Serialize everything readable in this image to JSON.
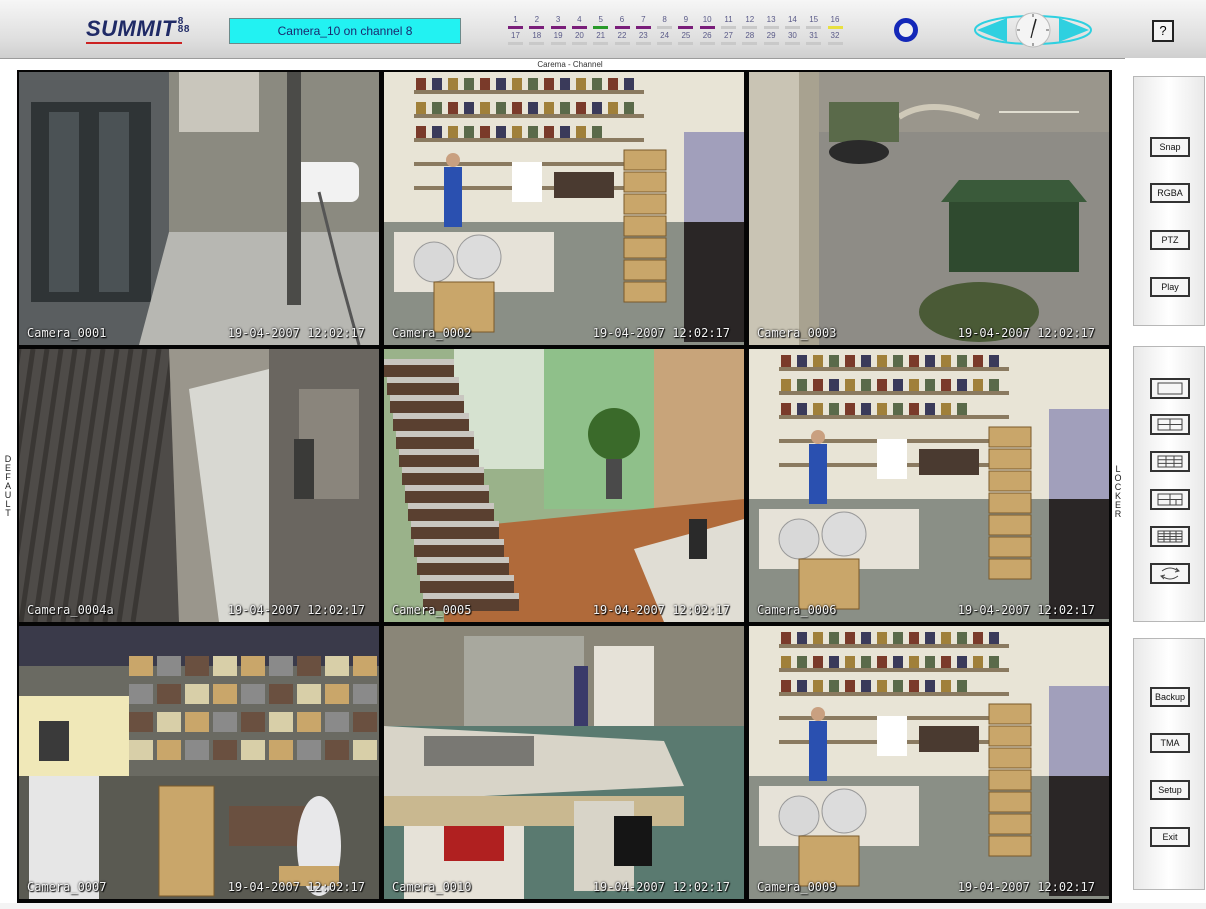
{
  "app": {
    "logo_text": "SUMMIT",
    "logo_badge_top": "8",
    "logo_badge_bottom": "88",
    "status_text": "Camera_10 on channel 8",
    "help_label": "?"
  },
  "grid": {
    "title": "Carema - Channel",
    "left_label": [
      "D",
      "E",
      "F",
      "A",
      "U",
      "L",
      "T"
    ],
    "right_label": [
      "L",
      "O",
      "C",
      "K",
      "E",
      "R"
    ]
  },
  "channels": [
    {
      "n": "1",
      "color": "#7a1e7a"
    },
    {
      "n": "2",
      "color": "#7a1e7a"
    },
    {
      "n": "3",
      "color": "#7a1e7a"
    },
    {
      "n": "4",
      "color": "#7a1e7a"
    },
    {
      "n": "5",
      "color": "#2a9a2a"
    },
    {
      "n": "6",
      "color": "#7a1e7a"
    },
    {
      "n": "7",
      "color": "#7a1e7a"
    },
    {
      "n": "8",
      "color": "#c9c9c9"
    },
    {
      "n": "9",
      "color": "#7a1e7a"
    },
    {
      "n": "10",
      "color": "#7a1e7a"
    },
    {
      "n": "11",
      "color": "#c9c9c9"
    },
    {
      "n": "12",
      "color": "#c9c9c9"
    },
    {
      "n": "13",
      "color": "#c9c9c9"
    },
    {
      "n": "14",
      "color": "#c9c9c9"
    },
    {
      "n": "15",
      "color": "#c9c9c9"
    },
    {
      "n": "16",
      "color": "#e8e040"
    },
    {
      "n": "17",
      "color": "#c9c9c9"
    },
    {
      "n": "18",
      "color": "#c9c9c9"
    },
    {
      "n": "19",
      "color": "#c9c9c9"
    },
    {
      "n": "20",
      "color": "#c9c9c9"
    },
    {
      "n": "21",
      "color": "#c9c9c9"
    },
    {
      "n": "22",
      "color": "#c9c9c9"
    },
    {
      "n": "23",
      "color": "#c9c9c9"
    },
    {
      "n": "24",
      "color": "#c9c9c9"
    },
    {
      "n": "25",
      "color": "#c9c9c9"
    },
    {
      "n": "26",
      "color": "#c9c9c9"
    },
    {
      "n": "27",
      "color": "#c9c9c9"
    },
    {
      "n": "28",
      "color": "#c9c9c9"
    },
    {
      "n": "29",
      "color": "#c9c9c9"
    },
    {
      "n": "30",
      "color": "#c9c9c9"
    },
    {
      "n": "31",
      "color": "#c9c9c9"
    },
    {
      "n": "32",
      "color": "#c9c9c9"
    }
  ],
  "cameras": [
    {
      "name": "Camera_0001",
      "timestamp": "19-04-2007 12:02:17",
      "scene": "entrance",
      "selected": false
    },
    {
      "name": "Camera_0002",
      "timestamp": "19-04-2007 12:02:17",
      "scene": "warehouse",
      "selected": false
    },
    {
      "name": "Camera_0003",
      "timestamp": "19-04-2007 12:02:17",
      "scene": "parking",
      "selected": false
    },
    {
      "name": "Camera_0004a",
      "timestamp": "19-04-2007 12:02:17",
      "scene": "corridor",
      "selected": false
    },
    {
      "name": "Camera_0005",
      "timestamp": "19-04-2007 12:02:17",
      "scene": "lobby",
      "selected": false
    },
    {
      "name": "Camera_0006",
      "timestamp": "19-04-2007 12:02:17",
      "scene": "warehouse",
      "selected": false
    },
    {
      "name": "Camera_0007",
      "timestamp": "19-04-2007 12:02:17",
      "scene": "storage",
      "selected": false
    },
    {
      "name": "Camera_0010",
      "timestamp": "19-04-2007 12:02:17",
      "scene": "reception",
      "selected": true
    },
    {
      "name": "Camera_0009",
      "timestamp": "19-04-2007 12:02:17",
      "scene": "warehouse",
      "selected": false
    }
  ],
  "side_panel": {
    "top_buttons": [
      "Snap",
      "RGBA",
      "PTZ",
      "Play"
    ],
    "layout_buttons": [
      "layout-1x1",
      "layout-2x2",
      "layout-3x3",
      "layout-mixed",
      "layout-4x4",
      "layout-cycle"
    ],
    "bottom_buttons": [
      "Backup",
      "TMA",
      "Setup",
      "Exit"
    ]
  },
  "colors": {
    "status_bg": "#22f2f2",
    "ring": "#1428b8",
    "selected_cell": "#8de08d"
  }
}
